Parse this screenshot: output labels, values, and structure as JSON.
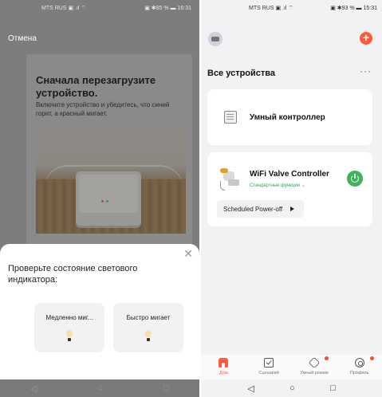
{
  "left": {
    "status": {
      "carrier": "MTS RUS ▣ .ıl ⌔",
      "right": "▣ ✱85 % ▬ 16:31"
    },
    "cancel_label": "Отмена",
    "card": {
      "title": "Сначала перезагрузите устройство.",
      "description": "Включите устройство и убедитесь, что синий горит, а красный мигает."
    },
    "sheet": {
      "close_glyph": "✕",
      "title": "Проверьте состояние светового индикатора:",
      "options": [
        {
          "label": "Медленно миг..."
        },
        {
          "label": "Быстро мигает"
        }
      ]
    },
    "nav": {
      "back": "◁",
      "home": "○",
      "recent": "□"
    }
  },
  "right": {
    "status": {
      "carrier": "MTS RUS ▣ .ıl ⌔",
      "right": "▣ ✱93 % ▬ 15:31"
    },
    "add_glyph": "+",
    "section_title": "Все устройства",
    "more_glyph": "···",
    "devices": [
      {
        "name": "Умный контроллер",
        "icon": "controller-icon"
      },
      {
        "name": "WiFi Valve Controller",
        "subtitle": "Стандартные функции ⌄",
        "icon": "valve-icon",
        "action_label": "Scheduled Power-off",
        "power_color": "#3eb45a"
      }
    ],
    "tabs": [
      {
        "label": "Дом",
        "icon": "home-icon",
        "active": true
      },
      {
        "label": "Сценарий",
        "icon": "scenario-icon"
      },
      {
        "label": "Умный режим",
        "icon": "smart-mode-icon"
      },
      {
        "label": "Профиль",
        "icon": "profile-icon"
      }
    ],
    "nav": {
      "back": "◁",
      "home": "○",
      "recent": "□"
    },
    "accent": "#ff5a3c"
  }
}
